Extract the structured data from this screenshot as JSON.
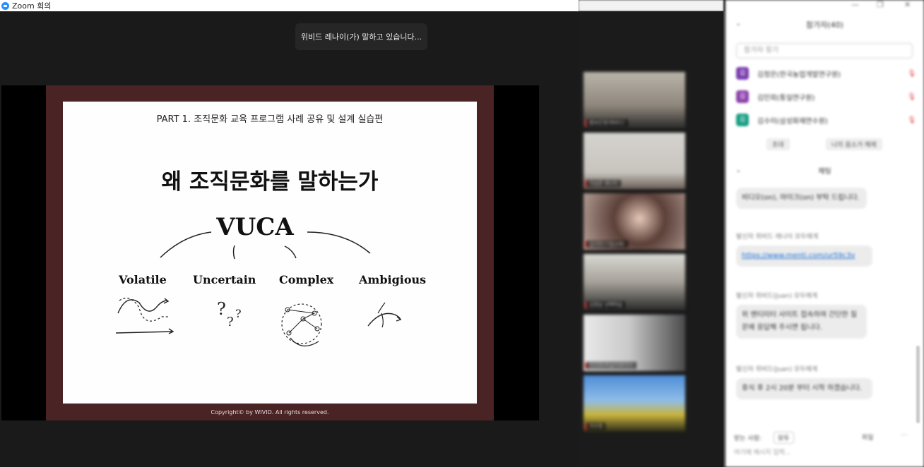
{
  "window": {
    "title": "Zoom 회의"
  },
  "toast": {
    "speaking": "위비드 레나이(가) 말하고 있습니다..."
  },
  "slide": {
    "part_title": "PART 1. 조직문화 교육 프로그램 사례 공유 및 설계 실습편",
    "headline": "왜 조직문화를 말하는가",
    "acronym": "VUCA",
    "terms": [
      "Volatile",
      "Uncertain",
      "Complex",
      "Ambigious"
    ],
    "copyright": "Copyright© by WIVID. All rights reserved."
  },
  "gallery": {
    "tiles": [
      {
        "name": "황보은정(위비드)"
      },
      {
        "name": "이승준 레나이"
      },
      {
        "name": "김지민(기업교육)"
      },
      {
        "name": "김정남 선택학습"
      },
      {
        "name": "이지희(퍼실리테이터)"
      },
      {
        "name": "지수정"
      }
    ]
  },
  "sidebar": {
    "title": "참가자(40)",
    "search_placeholder": "참가자 찾기",
    "participants": [
      {
        "initial": "김",
        "name": "김정은(한국농업개발연구원)",
        "color": "#7b3fb0"
      },
      {
        "initial": "김",
        "name": "김민희(통일연구원)",
        "color": "#8e44ad"
      },
      {
        "initial": "김",
        "name": "김수미(삼성화재연수원)",
        "color": "#1aa084"
      }
    ],
    "invite_label": "초대",
    "mute_all_label": "나의 음소거 해제",
    "chat_title": "채팅",
    "messages": [
      {
        "sender": "",
        "text": "비디오(on), 마이크(on) 부탁 드립니다."
      },
      {
        "sender": "발신자 위비드 레나이 모두에게",
        "text": "https://www.menti.com/ur59c3v"
      },
      {
        "sender": "발신자 위비드(Juan) 모두에게",
        "text": "위 멘티미터 사이트 접속하여 간단한 질문에 응답해 주시면 됩니다."
      },
      {
        "sender": "발신자 위비드(Juan) 모두에게",
        "text": "휴식 후 2시 20분 부터 시작 하겠습니다."
      }
    ],
    "composer": {
      "to_label": "받는 사람:",
      "to_value": "모두",
      "file_label": "파일",
      "more_label": "···",
      "input_placeholder": "여기에 메시지 입력..."
    }
  }
}
